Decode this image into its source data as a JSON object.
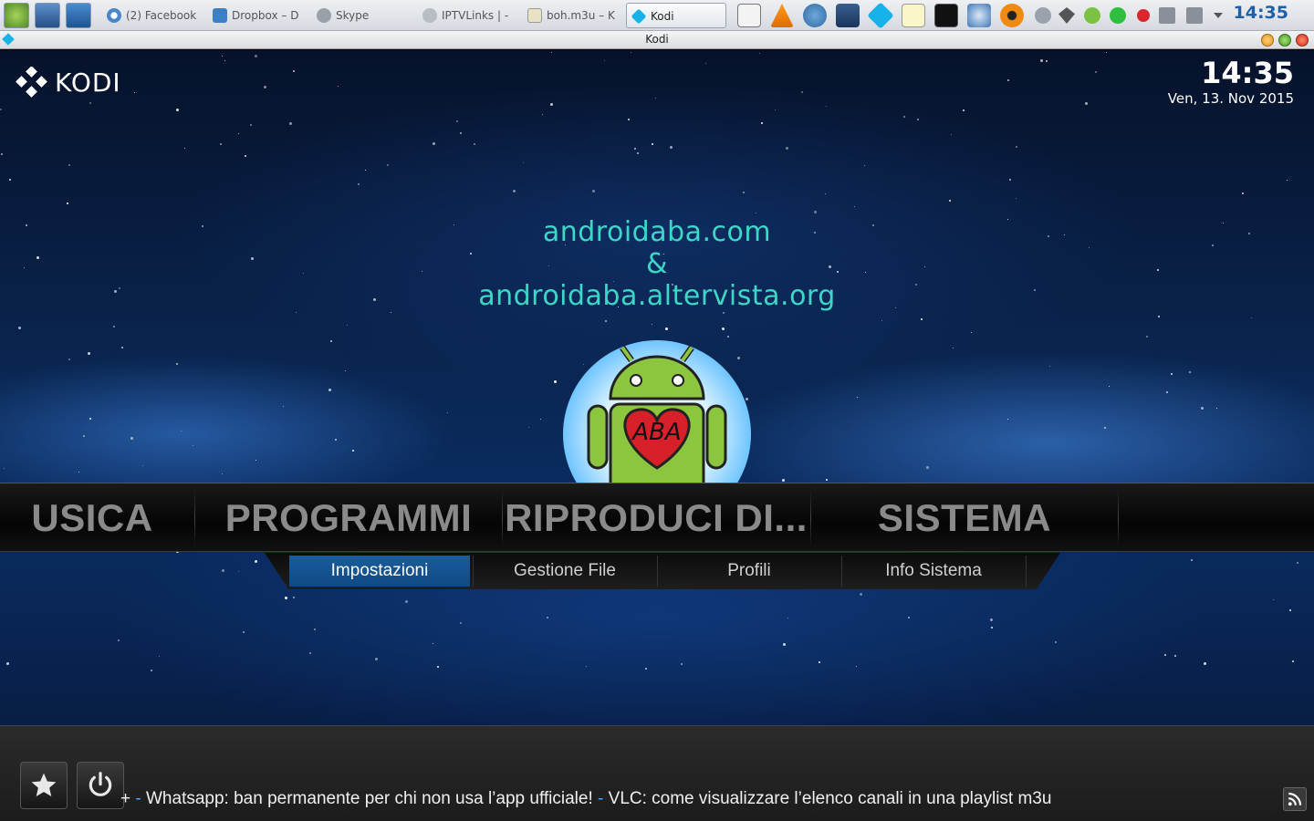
{
  "taskbar": {
    "launchers": [
      {
        "icon": "start-menu-icon",
        "color": "#7fb24a"
      },
      {
        "icon": "desktop-icon",
        "color": "#3b6ea5"
      },
      {
        "icon": "file-manager-icon",
        "color": "#2f6fb0"
      }
    ],
    "tasks": [
      {
        "label": "(2) Facebook",
        "icon": "chrome-icon",
        "active": false
      },
      {
        "label": "Dropbox – D",
        "icon": "dropbox-icon",
        "active": false
      },
      {
        "label": "Skype",
        "icon": "skype-icon",
        "active": false
      },
      {
        "label": "IPTVLinks | -",
        "icon": "browser-icon",
        "active": false
      },
      {
        "label": "boh.m3u – K",
        "icon": "text-editor-icon",
        "active": false
      },
      {
        "label": "Kodi",
        "icon": "kodi-icon",
        "active": true
      }
    ],
    "tray": [
      "notepad-icon",
      "vlc-icon",
      "download-icon",
      "video-icon",
      "kodi-tray-icon",
      "notes-icon",
      "terminal-icon",
      "search-tool-icon",
      "eye-icon",
      "sync-icon",
      "dropbox-tray-icon",
      "check-icon",
      "whatsapp-icon",
      "mega-icon",
      "volume-icon",
      "network-icon",
      "chevron-down-icon"
    ],
    "clock": "14:35"
  },
  "window": {
    "title": "Kodi",
    "app_icon": "kodi-small-icon"
  },
  "kodi": {
    "logo_text": "KODI",
    "time": "14:35",
    "date": "Ven, 13. Nov 2015",
    "brand_lines": [
      "androidaba.com",
      "&",
      "androidaba.altervista.org"
    ],
    "aba_logo_text": "ABA",
    "main_menu": [
      "USICA",
      "PROGRAMMI",
      "RIPRODUCI DI...",
      "SISTEMA"
    ],
    "submenu": [
      {
        "label": "Impostazioni",
        "selected": true
      },
      {
        "label": "Gestione File",
        "selected": false
      },
      {
        "label": "Profili",
        "selected": false
      },
      {
        "label": "Info Sistema",
        "selected": false
      }
    ],
    "footer": {
      "favourites_icon": "star-icon",
      "power_icon": "power-icon",
      "ticker": {
        "lead": "+",
        "sep": "-",
        "item1": "Whatsapp: ban permanente per chi non usa l’app ufficiale!",
        "item2": "VLC:  come visualizzare l’elenco canali in una playlist m3u"
      },
      "rss_icon": "rss-icon"
    }
  },
  "colors": {
    "accent": "#1a5c9c",
    "brand_text": "#3ed6c6",
    "kodi_blue": "#17b2e7"
  }
}
